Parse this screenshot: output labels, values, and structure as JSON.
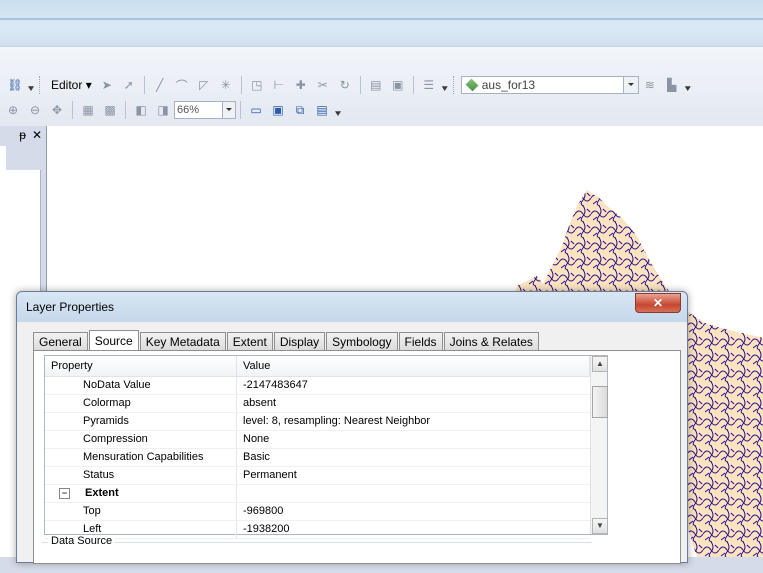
{
  "toolbar": {
    "editor_label": "Editor",
    "editor_arrow": "▾",
    "layer_name": "aus_for13",
    "zoom_value": "66%"
  },
  "toc": {
    "pin_glyph": "ᵽ",
    "close_glyph": "✕"
  },
  "dialog": {
    "title": "Layer Properties",
    "close_glyph": "✕",
    "tabs": [
      {
        "label": "General"
      },
      {
        "label": "Source"
      },
      {
        "label": "Key Metadata"
      },
      {
        "label": "Extent"
      },
      {
        "label": "Display"
      },
      {
        "label": "Symbology"
      },
      {
        "label": "Fields"
      },
      {
        "label": "Joins & Relates"
      }
    ],
    "selected_tab": "Source",
    "grid": {
      "headers": {
        "property": "Property",
        "value": "Value"
      },
      "rows": [
        {
          "property": "NoData Value",
          "value": "-2147483647"
        },
        {
          "property": "Colormap",
          "value": "absent"
        },
        {
          "property": "Pyramids",
          "value": "level: 8, resampling: Nearest Neighbor"
        },
        {
          "property": "Compression",
          "value": "None"
        },
        {
          "property": "Mensuration Capabilities",
          "value": "Basic"
        },
        {
          "property": "Status",
          "value": "Permanent"
        },
        {
          "property": "Extent",
          "value": "",
          "category": true,
          "expander": "−"
        },
        {
          "property": "Top",
          "value": "-969800"
        },
        {
          "property": "Left",
          "value": "-1938200"
        }
      ],
      "scroll_up": "▲",
      "scroll_down": "▼"
    },
    "data_source_label": "Data Source"
  },
  "colors": {
    "map_fill": "#fae3c0",
    "map_lines": "#2a0a8a",
    "close_red": "#c7462f"
  }
}
